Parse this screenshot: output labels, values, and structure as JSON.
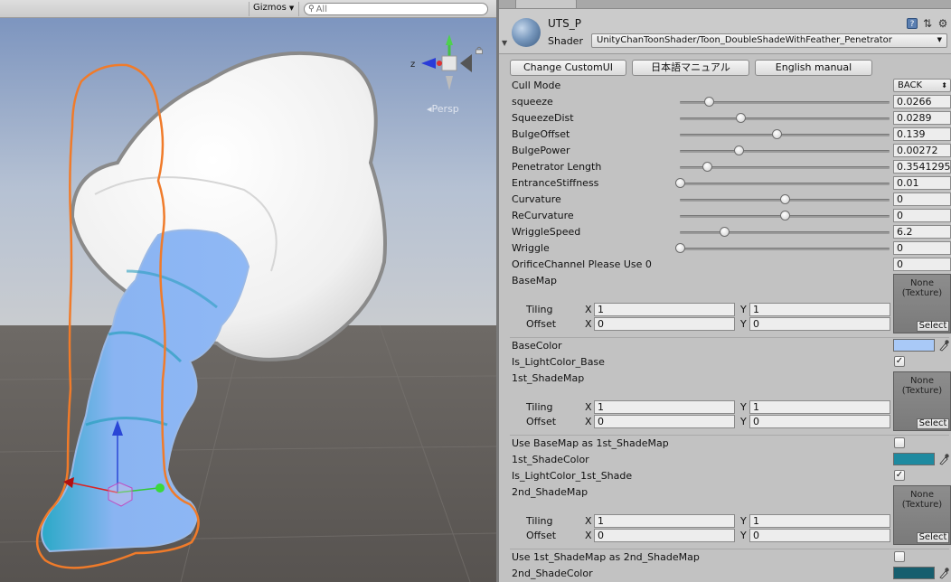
{
  "scene": {
    "gizmos_label": "Gizmos",
    "search_placeholder": "All",
    "persp_label": "Persp",
    "axis_z_label": "z"
  },
  "material": {
    "name": "UTS_P",
    "shader_label": "Shader",
    "shader_value": "UnityChanToonShader/Toon_DoubleShadeWithFeather_Penetrator"
  },
  "buttons": {
    "custom_ui": "Change CustomUI",
    "jp_manual": "日本語マニュアル",
    "en_manual": "English manual"
  },
  "cull_mode": {
    "label": "Cull Mode",
    "value": "BACK"
  },
  "sliders": [
    {
      "label": "squeeze",
      "value": "0.0266",
      "pos": 0.14
    },
    {
      "label": "SqueezeDist",
      "value": "0.0289",
      "pos": 0.29
    },
    {
      "label": "BulgeOffset",
      "value": "0.139",
      "pos": 0.46
    },
    {
      "label": "BulgePower",
      "value": "0.00272",
      "pos": 0.28
    },
    {
      "label": "Penetrator Length",
      "value": "0.3541295",
      "pos": 0.13
    },
    {
      "label": "EntranceStiffness",
      "value": "0.01",
      "pos": 0.0
    },
    {
      "label": "Curvature",
      "value": "0",
      "pos": 0.5
    },
    {
      "label": "ReCurvature",
      "value": "0",
      "pos": 0.5
    },
    {
      "label": "WriggleSpeed",
      "value": "6.2",
      "pos": 0.21
    },
    {
      "label": "Wriggle",
      "value": "0",
      "pos": 0.0
    }
  ],
  "orifice": {
    "label": "OrificeChannel Please Use 0",
    "value": "0"
  },
  "texture_none": "None",
  "texture_type": "(Texture)",
  "texture_select": "Select",
  "tiling_label": "Tiling",
  "offset_label": "Offset",
  "x_label": "X",
  "y_label": "Y",
  "base_map": {
    "label": "BaseMap",
    "tiling_x": "1",
    "tiling_y": "1",
    "offset_x": "0",
    "offset_y": "0"
  },
  "base_color": {
    "label": "BaseColor",
    "color": "#a9c9f7"
  },
  "is_light_base": {
    "label": "Is_LightColor_Base",
    "checked": true
  },
  "shade_map_1": {
    "label": "1st_ShadeMap",
    "tiling_x": "1",
    "tiling_y": "1",
    "offset_x": "0",
    "offset_y": "0"
  },
  "use_base_as_1st": {
    "label": "Use BaseMap as 1st_ShadeMap",
    "checked": false
  },
  "shade_color_1": {
    "label": "1st_ShadeColor",
    "color": "#1e8aa0"
  },
  "is_light_1st": {
    "label": "Is_LightColor_1st_Shade",
    "checked": true
  },
  "shade_map_2": {
    "label": "2nd_ShadeMap",
    "tiling_x": "1",
    "tiling_y": "1",
    "offset_x": "0",
    "offset_y": "0"
  },
  "use_1st_as_2nd": {
    "label": "Use 1st_ShadeMap as 2nd_ShadeMap",
    "checked": false
  },
  "shade_color_2": {
    "label": "2nd_ShadeColor",
    "color": "#165e6e"
  },
  "check_mark": "✓"
}
